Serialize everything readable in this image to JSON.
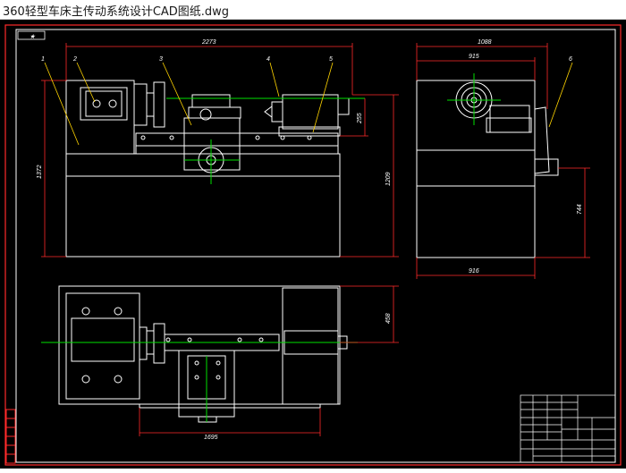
{
  "window": {
    "title": "360轻型车床主传动系统设计CAD图纸.dwg"
  },
  "colors": {
    "background": "#000000",
    "dimension": "#ff2a2a",
    "outline": "#ffffff",
    "centerline": "#00e000",
    "leader": "#ffd400"
  },
  "drawing": {
    "corner_tag": "★",
    "part_labels": [
      "1",
      "2",
      "3",
      "4",
      "5",
      "6"
    ],
    "dimensions": {
      "front_width": "2273",
      "front_height": "1372",
      "overall_height": "1209",
      "spindle_height": "255",
      "side_width": "1088",
      "side_inner_width": "915",
      "side_base_width": "916",
      "side_height": "744",
      "top_depth": "458",
      "top_length": "1695"
    }
  }
}
